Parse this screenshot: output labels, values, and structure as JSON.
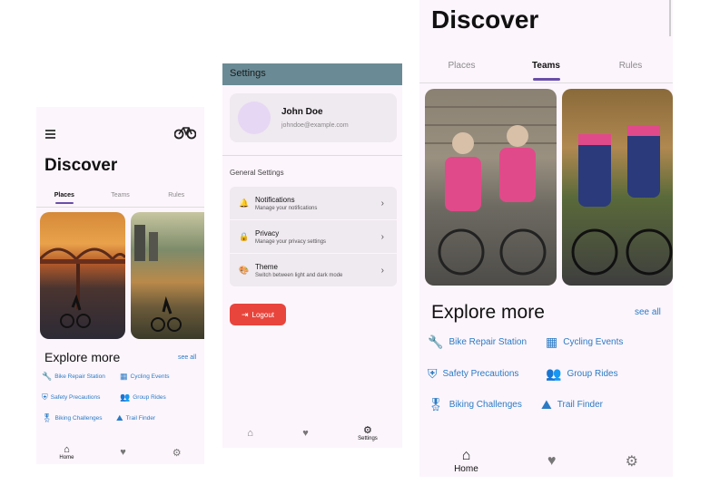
{
  "app": {
    "title": "Discover",
    "tabs": [
      "Places",
      "Teams",
      "Rules"
    ],
    "explore_title": "Explore more",
    "see_all": "see all",
    "explore_items": [
      {
        "label": "Bike Repair Station",
        "icon": "wrench-icon"
      },
      {
        "label": "Cycling Events",
        "icon": "calendar-icon"
      },
      {
        "label": "Safety Precautions",
        "icon": "shield-icon"
      },
      {
        "label": "Group Rides",
        "icon": "group-icon"
      },
      {
        "label": "Biking Challenges",
        "icon": "medal-icon"
      },
      {
        "label": "Trail Finder",
        "icon": "terrain-icon"
      }
    ],
    "nav": {
      "home": "Home",
      "settings": "Settings"
    }
  },
  "settings": {
    "appbar_title": "Settings",
    "profile": {
      "name": "John Doe",
      "email": "johndoe@example.com"
    },
    "section_title": "General Settings",
    "items": [
      {
        "title": "Notifications",
        "subtitle": "Manage your notifications",
        "icon": "bell-icon"
      },
      {
        "title": "Privacy",
        "subtitle": "Manage your privacy settings",
        "icon": "lock-icon"
      },
      {
        "title": "Theme",
        "subtitle": "Switch between light and dark mode",
        "icon": "palette-icon"
      }
    ],
    "logout_label": "Logout"
  },
  "colors": {
    "accent": "#6a4ea8",
    "link": "#2b7bc4",
    "logout": "#e8453c",
    "appbar": "#6a8b95"
  }
}
